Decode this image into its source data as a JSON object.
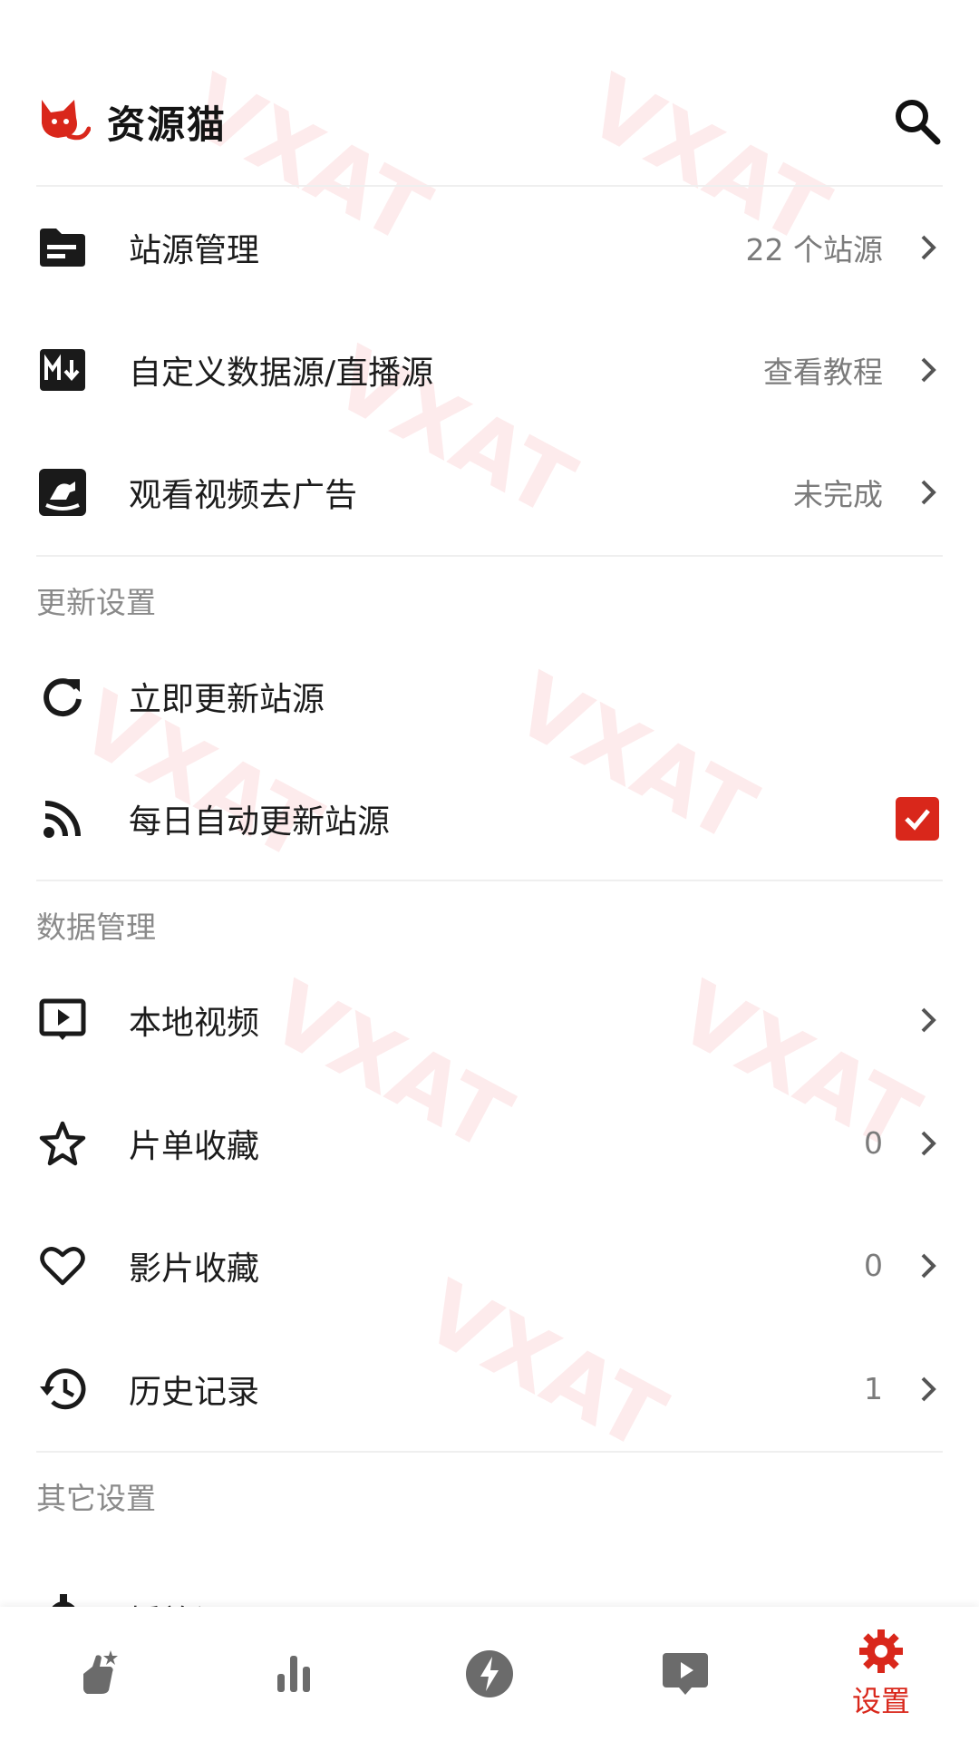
{
  "header": {
    "brand": "资源猫",
    "search_icon": "search-icon"
  },
  "menu_top": [
    {
      "label": "站源管理",
      "value": "22 个站源",
      "icon": "folder-list-icon"
    },
    {
      "label": "自定义数据源/直播源",
      "value": "查看教程",
      "icon": "markdown-icon"
    },
    {
      "label": "观看视频去广告",
      "value": "未完成",
      "icon": "rocking-horse-icon"
    }
  ],
  "section_update": {
    "title": "更新设置",
    "items": [
      {
        "label": "立即更新站源",
        "icon": "refresh-icon"
      },
      {
        "label": "每日自动更新站源",
        "icon": "rss-icon",
        "checked": true
      }
    ]
  },
  "section_data": {
    "title": "数据管理",
    "items": [
      {
        "label": "本地视频",
        "value": "",
        "icon": "video-screen-icon"
      },
      {
        "label": "片单收藏",
        "value": "0",
        "icon": "star-icon"
      },
      {
        "label": "影片收藏",
        "value": "0",
        "icon": "heart-icon"
      },
      {
        "label": "历史记录",
        "value": "1",
        "icon": "history-icon"
      }
    ]
  },
  "section_other": {
    "title": "其它设置",
    "items": [
      {
        "label": "播放设置",
        "icon": "gear-icon"
      }
    ]
  },
  "bottom_nav": [
    {
      "icon": "hand-star-icon",
      "label": ""
    },
    {
      "icon": "bar-chart-icon",
      "label": ""
    },
    {
      "icon": "lightning-icon",
      "label": ""
    },
    {
      "icon": "play-screen-icon",
      "label": ""
    },
    {
      "icon": "gear-icon",
      "label": "设置",
      "active": true
    }
  ],
  "watermark": "VXAT",
  "colors": {
    "accent": "#d9271b",
    "text": "#1c1c1c",
    "muted": "#7b7b7b",
    "section": "#8a8a8a"
  }
}
